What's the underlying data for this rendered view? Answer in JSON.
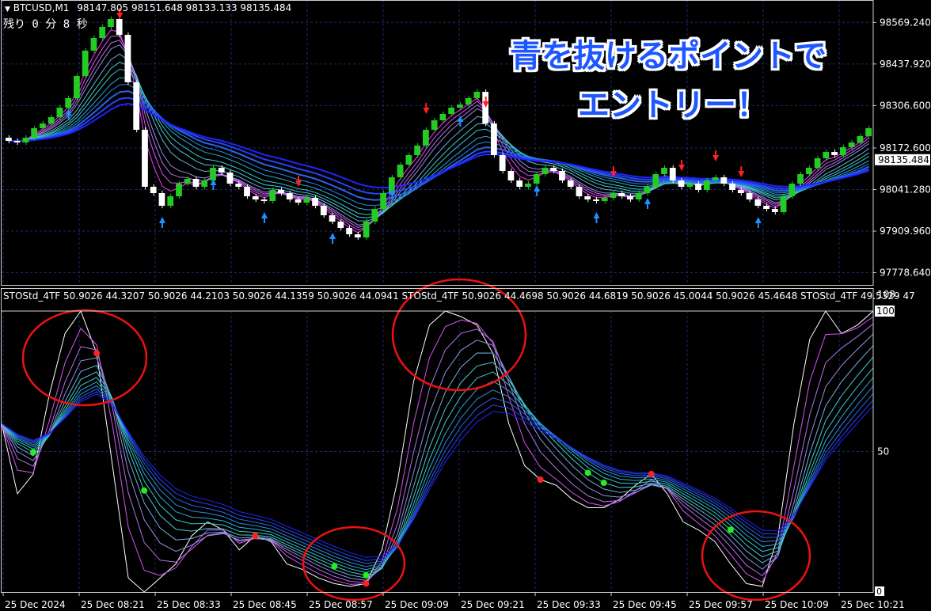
{
  "header": {
    "symbol_label": "BTCUSD,M1",
    "ohlc": "98147.805 98151.648 98133.133 98135.484",
    "remaining": "残り 0 分 8 秒"
  },
  "callout": {
    "line1": "青を抜けるポイントで",
    "line2": "エントリー！"
  },
  "indicator": {
    "label": "STOStd_4TF 50.9026 44.3207 50.9026 44.2103 50.9026 44.1359 50.9026 44.0941   STOStd_4TF 50.9026 44.4698 50.9026 44.6819 50.9026 45.0044 50.9026 45.4648   STOStd_4TF 49.5329 47",
    "max_label": "108",
    "high_label": "100",
    "mid_label": "50",
    "low_label": "0"
  },
  "price_axis": {
    "ticks": [
      "98569.240",
      "98437.920",
      "98306.600",
      "98172.600",
      "98041.280",
      "97909.960",
      "97778.640"
    ],
    "current_price": "98135.484"
  },
  "time_axis": {
    "ticks": [
      "25 Dec 2024",
      "25 Dec 08:21",
      "25 Dec 08:33",
      "25 Dec 08:45",
      "25 Dec 08:57",
      "25 Dec 09:09",
      "25 Dec 09:21",
      "25 Dec 09:33",
      "25 Dec 09:45",
      "25 Dec 09:57",
      "25 Dec 10:09",
      "25 Dec 10:21"
    ]
  },
  "colors": {
    "background": "#000000",
    "grid": "#1c2a6e",
    "bull": "#22cc22",
    "bear": "#ffffff",
    "ma_fast": "#ff33ff",
    "ma_mid": "#33ddcc",
    "ma_slow": "#2222ff",
    "signal_up": "#1e90ff",
    "signal_down": "#ff2020",
    "circle": "#ee1111",
    "callout_text": "#1f57ff"
  },
  "chart_data": [
    {
      "type": "candlestick",
      "symbol": "BTCUSD",
      "timeframe": "M1",
      "ylim": [
        97740,
        98640
      ],
      "close": [
        98195,
        98190,
        98205,
        98235,
        98250,
        98270,
        98300,
        98330,
        98400,
        98480,
        98520,
        98555,
        98580,
        98530,
        98380,
        98230,
        98050,
        98030,
        97990,
        98020,
        98060,
        98075,
        98050,
        98070,
        98110,
        98095,
        98060,
        98050,
        98020,
        98010,
        98005,
        98040,
        98030,
        98010,
        98000,
        98015,
        97990,
        97960,
        97940,
        97920,
        97900,
        97890,
        97940,
        97980,
        98030,
        98080,
        98120,
        98150,
        98180,
        98230,
        98260,
        98280,
        98300,
        98310,
        98330,
        98350,
        98250,
        98150,
        98100,
        98070,
        98050,
        98060,
        98090,
        98110,
        98100,
        98070,
        98050,
        98020,
        98010,
        98005,
        98015,
        98030,
        98020,
        98010,
        98030,
        98050,
        98090,
        98110,
        98070,
        98050,
        98060,
        98040,
        98070,
        98080,
        98060,
        98040,
        98030,
        98010,
        97990,
        97980,
        97970,
        98020,
        98060,
        98090,
        98110,
        98140,
        98160,
        98150,
        98175,
        98190,
        98210,
        98235
      ],
      "signals_down": [
        13,
        34,
        49,
        56,
        71,
        79,
        83,
        86
      ],
      "signals_up": [
        7,
        18,
        24,
        30,
        38,
        45,
        53,
        62,
        69,
        75,
        88
      ]
    },
    {
      "type": "line",
      "name": "STOStd_4TF",
      "ylim": [
        0,
        108
      ],
      "levels": [
        0,
        50,
        100
      ],
      "values": [
        60,
        35,
        42,
        70,
        92,
        100,
        85,
        45,
        5,
        0,
        5,
        10,
        20,
        25,
        22,
        15,
        20,
        18,
        10,
        8,
        5,
        3,
        2,
        3,
        15,
        40,
        75,
        95,
        100,
        98,
        95,
        85,
        60,
        45,
        40,
        38,
        33,
        30,
        30,
        33,
        38,
        42,
        35,
        25,
        22,
        18,
        10,
        3,
        2,
        20,
        60,
        90,
        100,
        92,
        95,
        100
      ],
      "dots_red": [
        6,
        16,
        23,
        34,
        41
      ],
      "dots_green": [
        2,
        9,
        21,
        23,
        37,
        38,
        46
      ]
    }
  ]
}
